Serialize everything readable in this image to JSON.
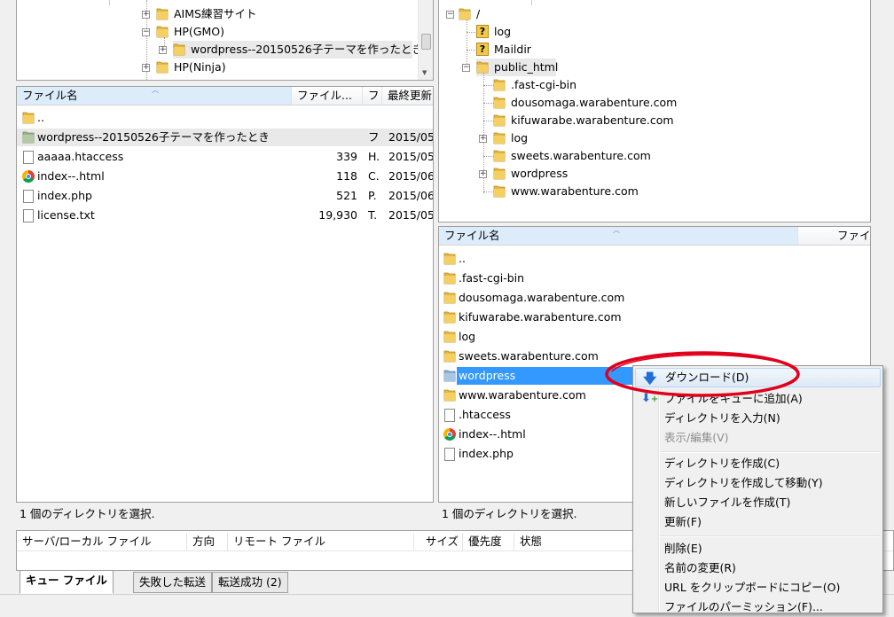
{
  "local_tree": {
    "items": [
      {
        "label": "AIMS練習サイト"
      },
      {
        "label": "HP(GMO)"
      },
      {
        "label": "wordpress--20150526子テーマを作ったとき"
      },
      {
        "label": "HP(Ninja)"
      }
    ]
  },
  "local_list": {
    "columns": [
      "ファイル名",
      "ファイル...",
      "フ",
      "最終更新"
    ],
    "rows": [
      {
        "name": "..",
        "size": "",
        "type": "",
        "date": ""
      },
      {
        "name": "wordpress--20150526子テーマを作ったとき",
        "size": "",
        "type": "フ",
        "date": "2015/05/"
      },
      {
        "name": "aaaaa.htaccess",
        "size": "339",
        "type": "H.",
        "date": "2015/05/"
      },
      {
        "name": "index--.html",
        "size": "118",
        "type": "C.",
        "date": "2015/06/"
      },
      {
        "name": "index.php",
        "size": "521",
        "type": "P.",
        "date": "2015/06/"
      },
      {
        "name": "license.txt",
        "size": "19,930",
        "type": "T.",
        "date": "2015/05/"
      }
    ],
    "status": "1 個のディレクトリを選択."
  },
  "remote_tree": {
    "root": "/",
    "items": [
      {
        "label": "log"
      },
      {
        "label": "Maildir"
      },
      {
        "label": "public_html"
      },
      {
        "label": ".fast-cgi-bin"
      },
      {
        "label": "dousomaga.warabenture.com"
      },
      {
        "label": "kifuwarabe.warabenture.com"
      },
      {
        "label": "log"
      },
      {
        "label": "sweets.warabenture.com"
      },
      {
        "label": "wordpress"
      },
      {
        "label": "www.warabenture.com"
      }
    ]
  },
  "remote_list": {
    "columns": [
      "ファイル名",
      "ファイ"
    ],
    "rows": [
      {
        "name": ".."
      },
      {
        "name": ".fast-cgi-bin"
      },
      {
        "name": "dousomaga.warabenture.com"
      },
      {
        "name": "kifuwarabe.warabenture.com"
      },
      {
        "name": "log"
      },
      {
        "name": "sweets.warabenture.com"
      },
      {
        "name": "wordpress"
      },
      {
        "name": "www.warabenture.com"
      },
      {
        "name": ".htaccess"
      },
      {
        "name": "index--.html"
      },
      {
        "name": "index.php"
      }
    ],
    "status": "1 個のディレクトリを選択."
  },
  "queue": {
    "columns": [
      "サーバ/ローカル ファイル",
      "方向",
      "リモート ファイル",
      "サイズ",
      "優先度",
      "状態"
    ],
    "tabs": [
      "キュー ファイル",
      "失敗した転送",
      "転送成功 (2)"
    ]
  },
  "context_menu": {
    "items": [
      "ダウンロード(D)",
      "ファイルをキューに追加(A)",
      "ディレクトリを入力(N)",
      "表示/編集(V)",
      "ディレクトリを作成(C)",
      "ディレクトリを作成して移動(Y)",
      "新しいファイルを作成(T)",
      "更新(F)",
      "削除(E)",
      "名前の変更(R)",
      "URL をクリップボードにコピー(O)",
      "ファイルのパーミッション(F)..."
    ]
  },
  "colors": {
    "selection": "#cfe8fc",
    "selected_remote": "#3399ff",
    "annotation_ellipse": "#e0001b",
    "folder": "#e7b83e"
  }
}
